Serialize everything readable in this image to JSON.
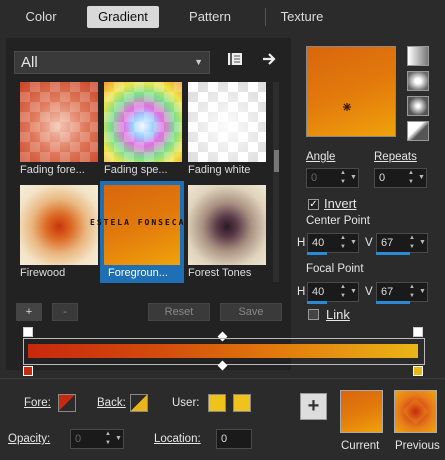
{
  "tabs": [
    {
      "label": "Color",
      "active": false
    },
    {
      "label": "Gradient",
      "active": true
    },
    {
      "label": "Pattern",
      "active": false
    },
    {
      "label": "Texture",
      "active": false
    }
  ],
  "library": {
    "category": "All",
    "presets": [
      {
        "label": "Fading fore...",
        "selected": false
      },
      {
        "label": "Fading spe...",
        "selected": false
      },
      {
        "label": "Fading white",
        "selected": false
      },
      {
        "label": "Firewood",
        "selected": false
      },
      {
        "label": "Foregroun...",
        "selected": true
      },
      {
        "label": "Forest Tones",
        "selected": false
      }
    ],
    "watermark": "ESTELA FONSECA"
  },
  "buttons": {
    "add": "+",
    "remove": "-",
    "reset": "Reset",
    "save": "Save",
    "add_current": "+"
  },
  "settings": {
    "angle_label": "Angle",
    "angle_value": "0",
    "repeats_label": "Repeats",
    "repeats_value": "0",
    "invert_label": "Invert",
    "invert_checked": true,
    "center_point_label": "Center Point",
    "center_h_label": "H",
    "center_h_value": "40",
    "center_v_label": "V",
    "center_v_value": "67",
    "focal_point_label": "Focal Point",
    "focal_h_label": "H",
    "focal_h_value": "40",
    "focal_v_label": "V",
    "focal_v_value": "67",
    "link_label": "Link",
    "link_checked": false
  },
  "bottom": {
    "fore_label": "Fore:",
    "back_label": "Back:",
    "user_label": "User:",
    "opacity_label": "Opacity:",
    "opacity_value": "0",
    "location_label": "Location:",
    "location_value": "0",
    "current_label": "Current",
    "previous_label": "Previous"
  },
  "colors": {
    "fore": "#c8280e",
    "back": "#eab518",
    "user1": "#f0c21c",
    "user2": "#f0c21c",
    "accent": "#2a8ad4"
  }
}
